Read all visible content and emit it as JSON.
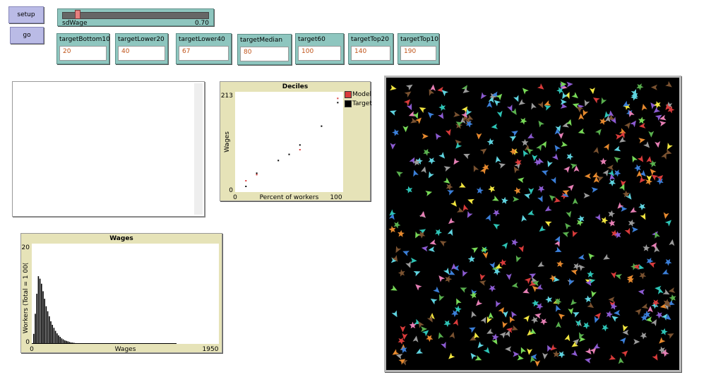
{
  "buttons": {
    "setup": "setup",
    "go": "go"
  },
  "slider": {
    "label": "sdWage",
    "value": "0.70",
    "fraction": 0.1
  },
  "inputs": [
    {
      "label": "targetBottom10",
      "value": "20"
    },
    {
      "label": "targetLower20",
      "value": "40"
    },
    {
      "label": "targetLower40",
      "value": "67"
    },
    {
      "label": "targetMedian",
      "value": "80"
    },
    {
      "label": "target60",
      "value": "100"
    },
    {
      "label": "targetTop20",
      "value": "140"
    },
    {
      "label": "targetTop10",
      "value": "190"
    }
  ],
  "chart_data": [
    {
      "type": "scatter",
      "title": "Deciles",
      "xlabel": "Percent of workers",
      "ylabel": "Wages",
      "xlim": [
        0,
        100
      ],
      "ylim": [
        0,
        213
      ],
      "x_tick_labels": [
        "0",
        "100"
      ],
      "y_tick_labels": [
        "0",
        "213"
      ],
      "legend_placement": "top-right",
      "series": [
        {
          "name": "Model",
          "color": "#d93b3b",
          "points": [
            [
              10,
              24
            ],
            [
              20,
              37
            ],
            [
              60,
              90
            ],
            [
              95,
              199
            ]
          ]
        },
        {
          "name": "Target",
          "color": "#000000",
          "points": [
            [
              10,
              12
            ],
            [
              20,
              40
            ],
            [
              40,
              67
            ],
            [
              50,
              80
            ],
            [
              60,
              100
            ],
            [
              80,
              140
            ],
            [
              95,
              190
            ]
          ]
        }
      ]
    },
    {
      "type": "bar",
      "title": "Wages",
      "xlabel": "Wages",
      "ylabel": "Workers (Total = 1 00(",
      "xlim": [
        0,
        1950
      ],
      "ylim": [
        0,
        20
      ],
      "x_tick_labels": [
        "0",
        "1950"
      ],
      "y_tick_labels": [
        "0",
        "20"
      ],
      "bar_color": "#000000",
      "values": [
        2,
        6,
        10,
        13.5,
        13,
        12,
        10.5,
        9,
        7.5,
        6.5,
        5.5,
        4.5,
        3.8,
        3.2,
        2.6,
        2.1,
        1.7,
        1.4,
        1.1,
        0.9,
        0.7,
        0.6,
        0.5,
        0.4,
        0.3,
        0.25,
        0.2,
        0.15,
        0.12,
        0.1
      ]
    }
  ],
  "world": {
    "background": "#000000",
    "turtle_count": 520,
    "turtle_colors": [
      "#d93b3b",
      "#e6892e",
      "#f2e640",
      "#59b04e",
      "#2ec4b6",
      "#3b7fd9",
      "#8c5bd1",
      "#e67fb5",
      "#9b9b9b",
      "#7a5230",
      "#77d957",
      "#5fd4e0"
    ]
  }
}
